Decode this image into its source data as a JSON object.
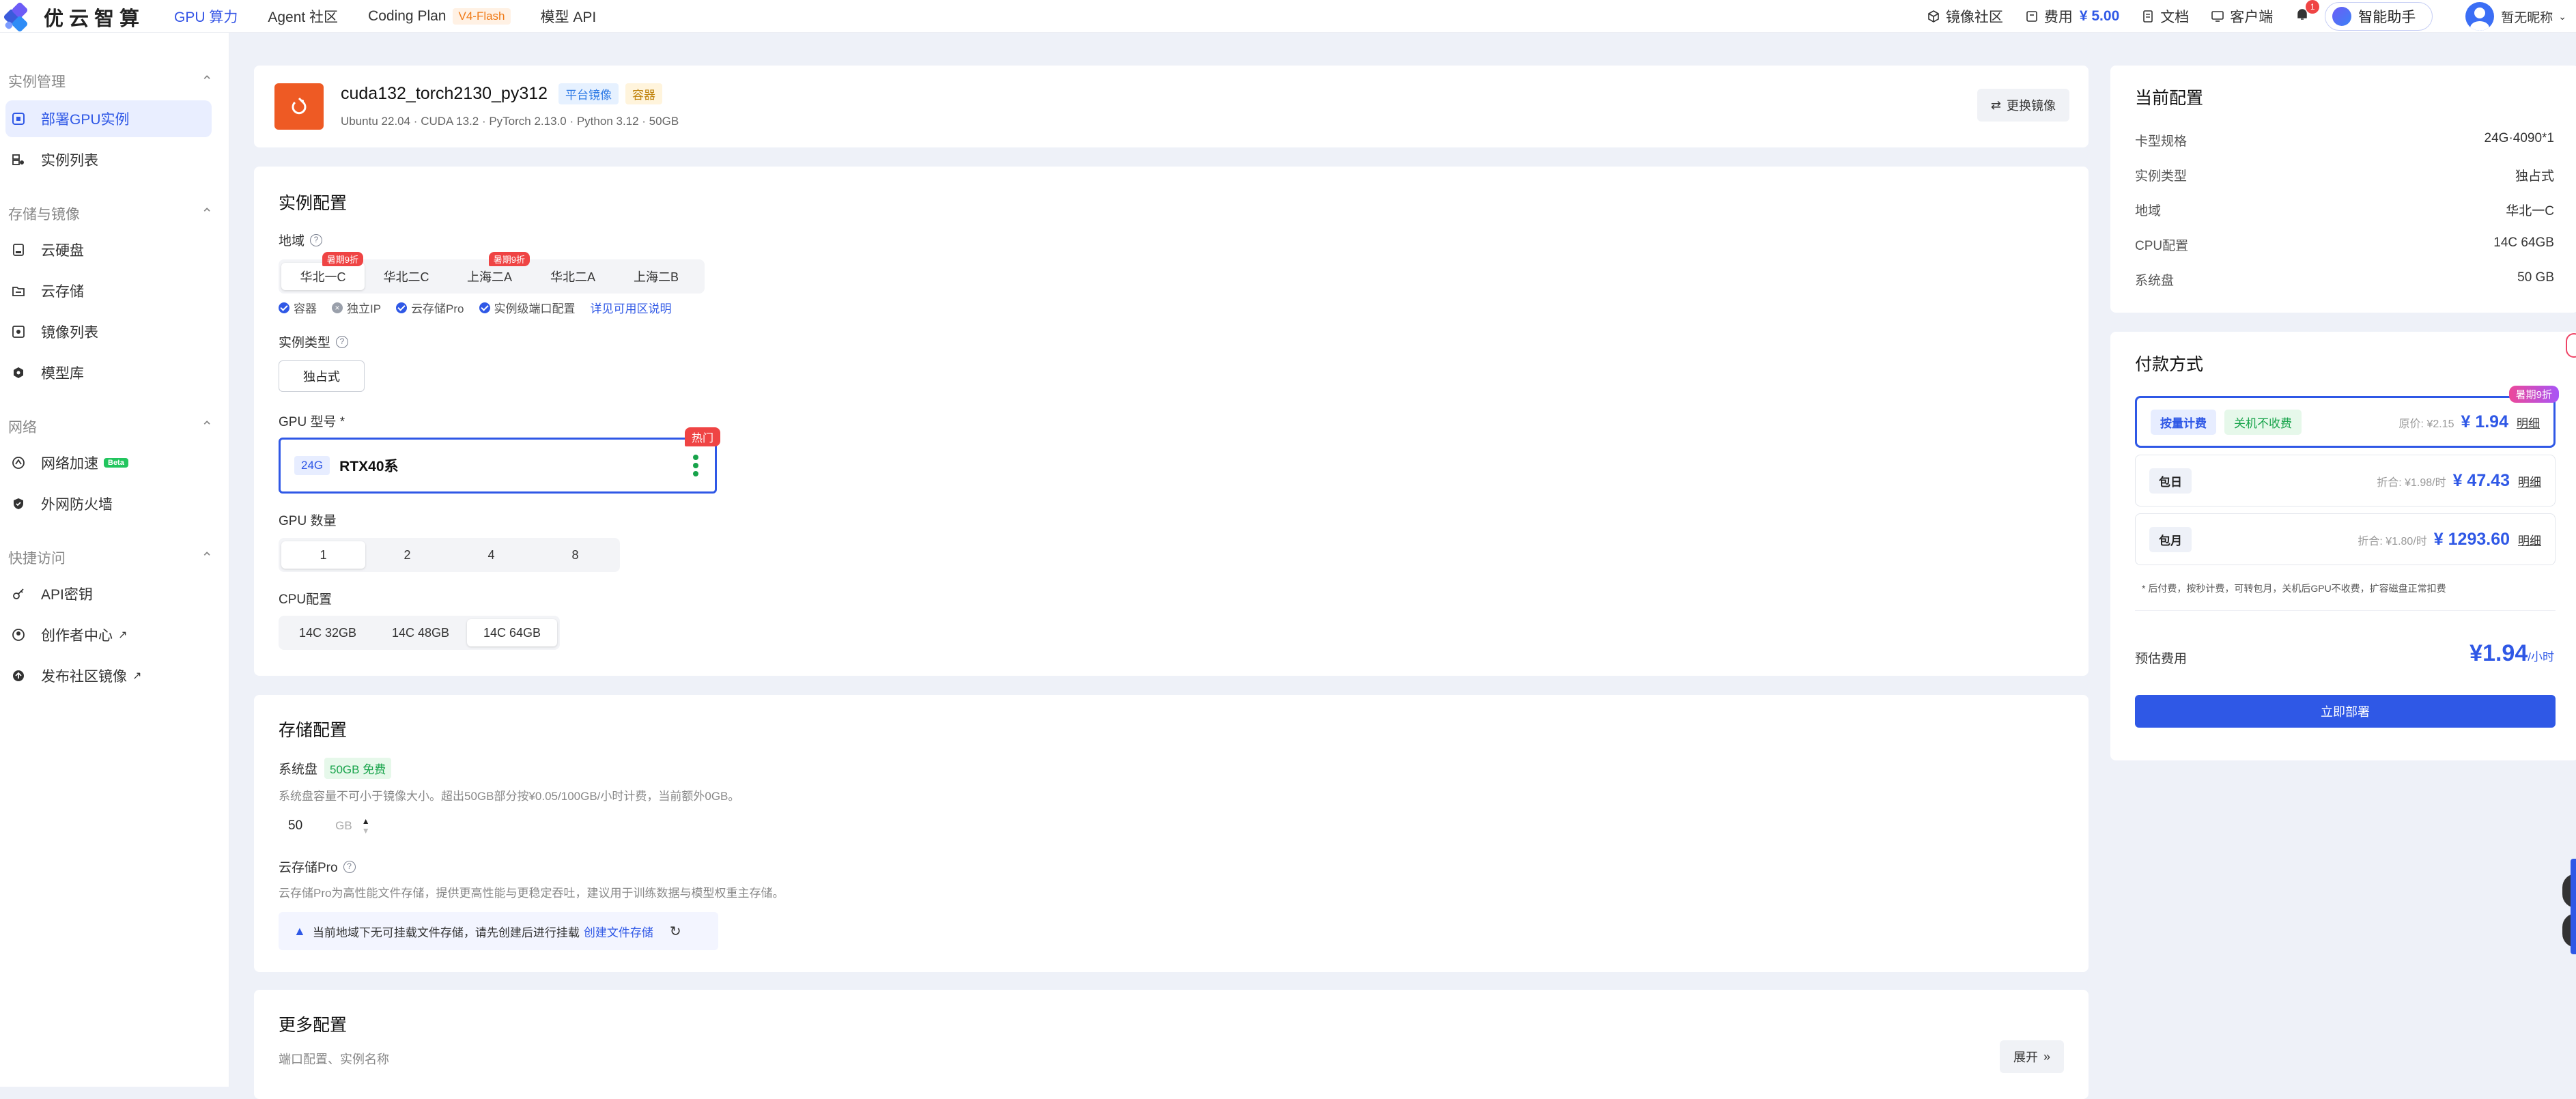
{
  "topbar": {
    "logo_text": "优云智算",
    "nav": [
      {
        "label": "GPU 算力"
      },
      {
        "label": "Agent 社区"
      },
      {
        "label": "Coding Plan",
        "badge": "V4-Flash"
      },
      {
        "label": "模型 API"
      }
    ],
    "mirror_community": "镜像社区",
    "fee_label": "费用",
    "fee_value": "¥ 5.00",
    "docs": "文档",
    "client": "客户端",
    "notification_count": "1",
    "ai_assistant": "智能助手",
    "username": "暂无昵称"
  },
  "sidebar": {
    "groups": [
      {
        "title": "实例管理",
        "items": [
          {
            "label": "部署GPU实例",
            "icon": "deploy-icon"
          },
          {
            "label": "实例列表",
            "icon": "list-icon"
          }
        ]
      },
      {
        "title": "存储与镜像",
        "items": [
          {
            "label": "云硬盘",
            "icon": "disk-icon"
          },
          {
            "label": "云存储",
            "icon": "folder-icon"
          },
          {
            "label": "镜像列表",
            "icon": "image-icon"
          },
          {
            "label": "模型库",
            "icon": "model-icon"
          }
        ]
      },
      {
        "title": "网络",
        "items": [
          {
            "label": "网络加速",
            "icon": "accelerate-icon",
            "badge": "Beta"
          },
          {
            "label": "外网防火墙",
            "icon": "shield-icon"
          }
        ]
      },
      {
        "title": "快捷访问",
        "items": [
          {
            "label": "API密钥",
            "icon": "key-icon"
          },
          {
            "label": "创作者中心",
            "icon": "user-icon"
          },
          {
            "label": "发布社区镜像",
            "icon": "publish-icon"
          }
        ]
      }
    ]
  },
  "image_card": {
    "name": "cuda132_torch2130_py312",
    "tag1": "平台镜像",
    "tag2": "容器",
    "meta": "Ubuntu 22.04 · CUDA 13.2 · PyTorch 2.13.0 · Python 3.12 · 50GB",
    "change_button": "更换镜像"
  },
  "instance_config": {
    "title": "实例配置",
    "region_label": "地域",
    "regions": [
      {
        "label": "华北一C",
        "hot": "暑期9折"
      },
      {
        "label": "华北二C",
        "hot": ""
      },
      {
        "label": "上海二A",
        "hot": "暑期9折"
      },
      {
        "label": "华北二A",
        "hot": ""
      },
      {
        "label": "上海二B",
        "hot": ""
      }
    ],
    "features": [
      "容器",
      "独立IP",
      "云存储Pro",
      "实例级端口配置"
    ],
    "region_link": "详见可用区说明",
    "type_label": "实例类型",
    "type_value": "独占式",
    "gpu_model_label": "GPU 型号 *",
    "gpu_mem": "24G",
    "gpu_name": "RTX40系",
    "gpu_hot": "热门",
    "gpu_count_label": "GPU 数量",
    "gpu_counts": [
      "1",
      "2",
      "4",
      "8"
    ],
    "cpu_label": "CPU配置",
    "cpu_options": [
      "14C 32GB",
      "14C 48GB",
      "14C 64GB"
    ]
  },
  "storage_config": {
    "title": "存储配置",
    "system_disk_label": "系统盘",
    "system_disk_free": "50GB 免费",
    "system_disk_hint": "系统盘容量不可小于镜像大小。超出50GB部分按¥0.05/100GB/小时计费，当前额外0GB。",
    "disk_value": "50",
    "disk_unit": "GB",
    "pro_label": "云存储Pro",
    "pro_hint": "云存储Pro为高性能文件存储，提供更高性能与更稳定吞吐，建议用于训练数据与模型权重主存储。",
    "warning": "当前地域下无可挂载文件存储，请先创建后进行挂载",
    "warning_link": "创建文件存储"
  },
  "more_config": {
    "title": "更多配置",
    "subtitle": "端口配置、实例名称",
    "expand": "展开"
  },
  "current_config": {
    "title": "当前配置",
    "rows": [
      {
        "k": "卡型规格",
        "v": "24G·4090*1"
      },
      {
        "k": "实例类型",
        "v": "独占式"
      },
      {
        "k": "地域",
        "v": "华北一C"
      },
      {
        "k": "CPU配置",
        "v": "14C 64GB"
      },
      {
        "k": "系统盘",
        "v": "50 GB"
      }
    ]
  },
  "payment": {
    "title": "付款方式",
    "promo": "暑期9折",
    "options": [
      {
        "tag": "按量计费",
        "extra": "关机不收费",
        "orig": "原价: ¥2.15",
        "price": "¥ 1.94",
        "detail": "明细"
      },
      {
        "tag": "包日",
        "extra": "",
        "orig": "折合: ¥1.98/时",
        "price": "¥ 47.43",
        "detail": "明细"
      },
      {
        "tag": "包月",
        "extra": "",
        "orig": "折合: ¥1.80/时",
        "price": "¥ 1293.60",
        "detail": "明细"
      }
    ],
    "note": "* 后付费，按秒计费，可转包月，关机后GPU不收费，扩容磁盘正常扣费",
    "estimate_label": "预估费用",
    "estimate_value": "¥1.94",
    "estimate_unit": "/小时",
    "deploy_button": "立即部署"
  },
  "colors": {
    "accent": "#2f58e6",
    "hot": "#ef4444",
    "warning_bg": "#f3f5ff"
  }
}
